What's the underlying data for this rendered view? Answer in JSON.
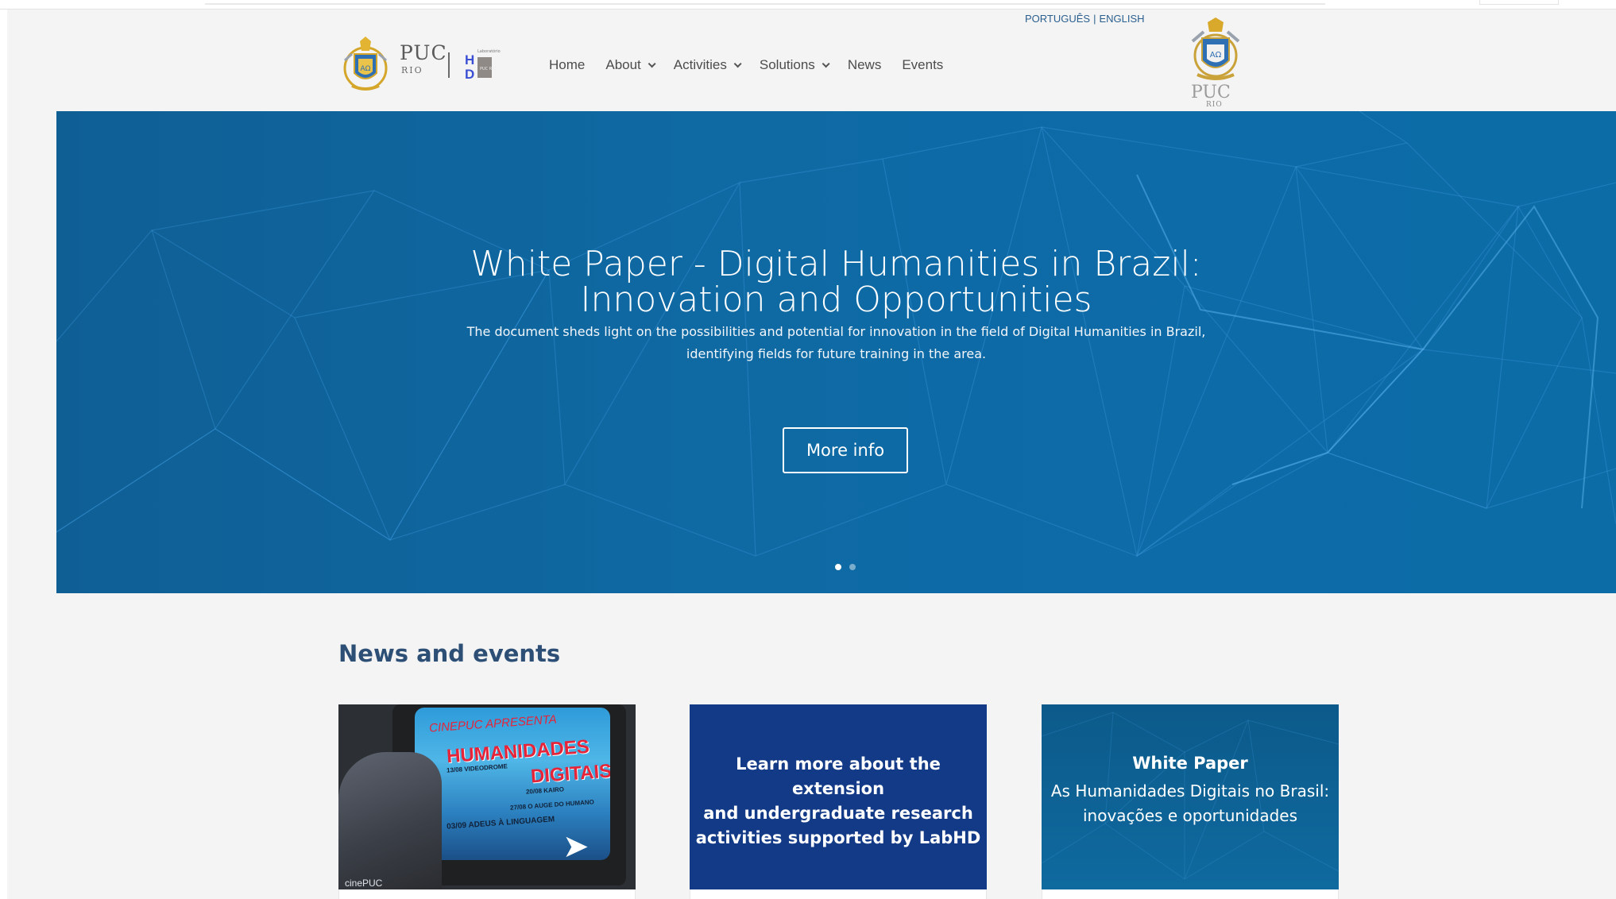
{
  "header": {
    "lang": {
      "pt": "PORTUGUÊS",
      "separator": "|",
      "en": "ENGLISH"
    },
    "logo_left": {
      "puc": "PUC",
      "rio": "RIO",
      "lab_letters_h": "H",
      "lab_letters_d": "D",
      "lab_small": "Laboratório",
      "lab_mini": "PUC RIO"
    },
    "logo_right": {
      "puc": "PUC",
      "rio": "RIO"
    },
    "nav": [
      {
        "label": "Home",
        "has_dropdown": false
      },
      {
        "label": "About",
        "has_dropdown": true
      },
      {
        "label": "Activities",
        "has_dropdown": true
      },
      {
        "label": "Solutions",
        "has_dropdown": true
      },
      {
        "label": "News",
        "has_dropdown": false
      },
      {
        "label": "Events",
        "has_dropdown": false
      }
    ]
  },
  "hero": {
    "title_line1": "White Paper - Digital Humanities in Brazil:",
    "title_line2": "Innovation and Opportunities",
    "description": "The document sheds light on the possibilities and potential for innovation in the field of Digital Humanities in Brazil, identifying fields for future training in the area.",
    "button_label": "More info",
    "slide_count": 2,
    "active_slide": 1
  },
  "news": {
    "section_title": "News and events",
    "cards": [
      {
        "kind": "photo",
        "tv_lines": {
          "t1": "CINEPUC APRESENTA",
          "t2": "HUMANIDADES",
          "t3": "DIGITAIS",
          "l1": "13/08 VIDEODROME",
          "l2": "20/08 KAIRO",
          "l3": "27/08 O AUGE DO HUMANO",
          "l4": "03/09 ADEUS À LINGUAGEM"
        },
        "footer": "cinePUC"
      },
      {
        "kind": "text",
        "text_line1": "Learn more about the extension",
        "text_line2": "and undergraduate research",
        "text_line3": "activities supported by LabHD"
      },
      {
        "kind": "text",
        "title": "White Paper",
        "text_line1": "As Humanidades Digitais no Brasil:",
        "text_line2": "inovações e oportunidades"
      }
    ]
  },
  "colors": {
    "accent_link": "#2b5f8f",
    "hero_blue": "#0f6aa4",
    "card2_blue": "#133a87",
    "news_title": "#2d4f76"
  }
}
